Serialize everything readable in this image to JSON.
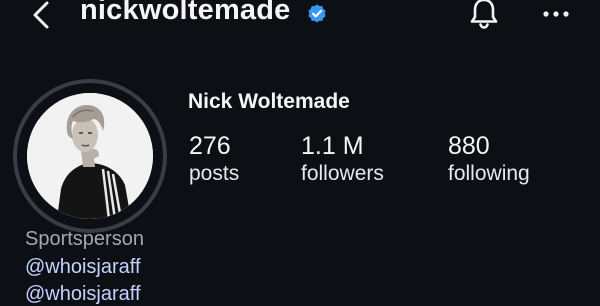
{
  "header": {
    "username": "nickwoltemade",
    "verified": true,
    "icons": {
      "back": "chevron-left-icon",
      "verified": "verified-badge-icon",
      "notifications": "bell-icon",
      "more": "more-horizontal-icon"
    }
  },
  "profile": {
    "full_name": "Nick Woltemade",
    "stats": [
      {
        "value": "276",
        "label": "posts"
      },
      {
        "value": "1.1 M",
        "label": "followers"
      },
      {
        "value": "880",
        "label": "following"
      }
    ],
    "category": "Sportsperson",
    "links": [
      "@whoisjaraff",
      "@whoisjaraff"
    ]
  },
  "colors": {
    "background": "#0c0f14",
    "verified_blue": "#3897f0",
    "link": "#c5d3ff",
    "category": "#a3a8b2",
    "story_ring": "#3a3d44"
  }
}
